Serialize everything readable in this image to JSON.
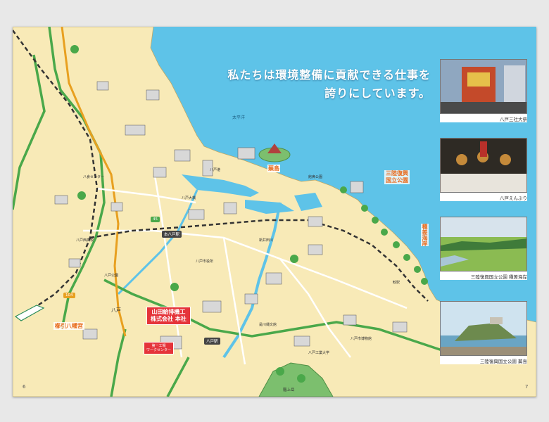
{
  "headline": {
    "line1": "私たちは環境整備に貢献できる仕事を",
    "line2": "誇りにしています。"
  },
  "photos": [
    {
      "caption": "八戸三社大祭",
      "icon": "festival-float-photo"
    },
    {
      "caption": "八戸えんぶり",
      "icon": "enburi-dance-photo"
    },
    {
      "caption": "三陸復興国立公園 種差海岸",
      "icon": "grassland-coast-photo"
    },
    {
      "caption": "三陸復興国立公園 蕪島",
      "icon": "kabushima-island-photo"
    }
  ],
  "map": {
    "sea_label": "太平洋",
    "kabushima": "蕪島",
    "park_line1": "三陸復興",
    "park_line2": "国立公園",
    "tanesashi": "種差海岸",
    "kushihiki": "櫛引八幡宮",
    "hq_line1": "山田給排機工",
    "hq_line2": "株式会社 本社",
    "factory_line1": "第一工場",
    "factory_line2": "ワークセンター",
    "hachinohe": "八戸",
    "hachinohe_station": "八戸駅",
    "honhachinohe": "本八戸駅",
    "road_104": "104",
    "road_45": "45",
    "mountain": "階上岳",
    "small_labels": [
      "八戸港",
      "八食センター",
      "八戸市役所",
      "八戸西高校",
      "八戸大橋",
      "八戸工業大学",
      "鮫駅",
      "館鼻公園",
      "八戸公園",
      "是川縄文館",
      "新井田川",
      "八戸市博物館"
    ]
  },
  "page_numbers": {
    "left": "6",
    "right": "7"
  },
  "colors": {
    "sea": "#5ec3e8",
    "land": "#f8eab7",
    "road_main": "#4aa84a",
    "road_sub": "#ffffff",
    "rail": "#333333",
    "accent": "#e86c1e",
    "hq": "#e5343a"
  }
}
